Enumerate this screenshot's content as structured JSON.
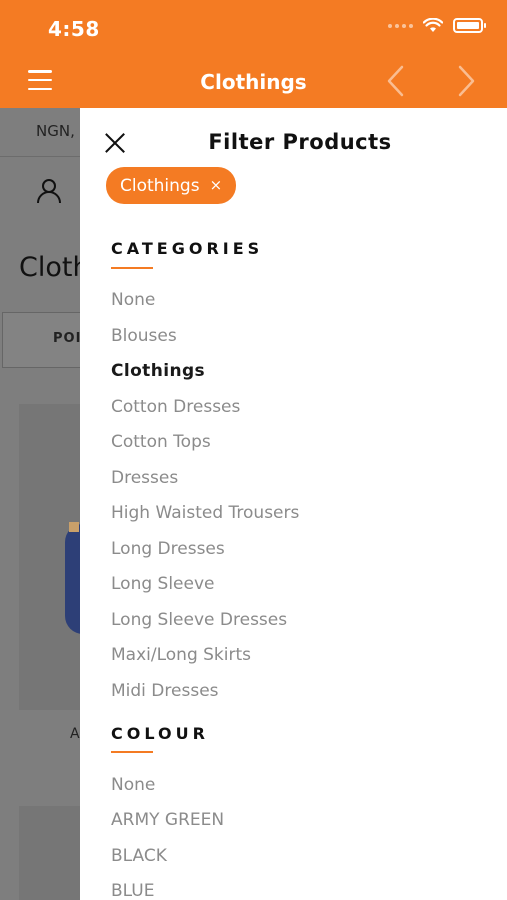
{
  "status_bar": {
    "time": "4:58"
  },
  "header": {
    "title": "Clothings"
  },
  "background": {
    "currency": "NGN,",
    "page_title": "Cloth",
    "sort_label": "POI",
    "product_letter": "A"
  },
  "drawer": {
    "title": "Filter Products",
    "active_chip": {
      "label": "Clothings",
      "remove": "×"
    },
    "categories": {
      "heading": "CATEGORIES",
      "options": [
        "None",
        "Blouses",
        "Clothings",
        "Cotton Dresses",
        "Cotton Tops",
        "Dresses",
        "High Waisted Trousers",
        "Long Dresses",
        "Long Sleeve",
        "Long Sleeve Dresses",
        "Maxi/Long Skirts",
        "Midi Dresses"
      ],
      "selected": "Clothings"
    },
    "colour": {
      "heading": "COLOUR",
      "options": [
        "None",
        "ARMY GREEN",
        "BLACK",
        "BLUE"
      ]
    }
  },
  "colors": {
    "accent": "#f47b23",
    "overlay": "#7e7e7e"
  }
}
